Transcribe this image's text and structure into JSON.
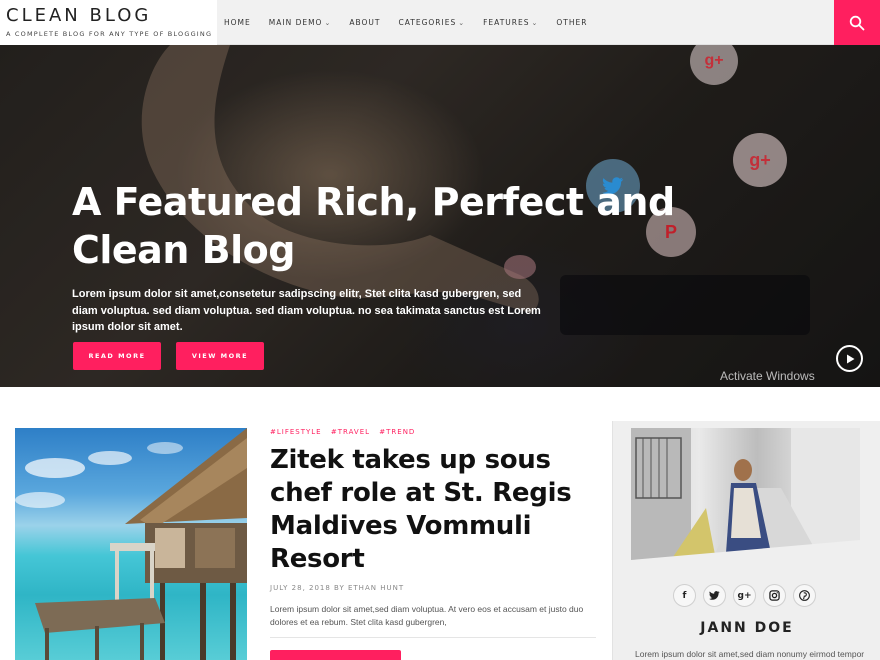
{
  "brand": {
    "title": "CLEAN BLOG",
    "tagline": "A COMPLETE BLOG FOR ANY TYPE OF BLOGGING"
  },
  "nav": {
    "items": [
      {
        "label": "HOME",
        "has_dropdown": false
      },
      {
        "label": "MAIN DEMO",
        "has_dropdown": true
      },
      {
        "label": "ABOUT",
        "has_dropdown": false
      },
      {
        "label": "CATEGORIES",
        "has_dropdown": true
      },
      {
        "label": "FEATURES",
        "has_dropdown": true
      },
      {
        "label": "OTHER",
        "has_dropdown": false
      }
    ],
    "chevron_glyph": "⌄",
    "search_icon": "search-icon"
  },
  "hero": {
    "title": "A Featured Rich, Perfect and Clean Blog",
    "description": "Lorem ipsum dolor sit amet,consetetur sadipscing elitr, Stet clita kasd gubergren, sed diam voluptua. sed diam voluptua. sed diam voluptua. no sea takimata sanctus est Lorem ipsum dolor sit amet.",
    "read_more_label": "READ MORE",
    "view_more_label": "VIEW MORE",
    "watermark": "Activate Windows"
  },
  "post": {
    "tags": [
      "#LIFESTYLE",
      "#TRAVEL",
      "#TREND"
    ],
    "title": "Zitek takes up sous chef role at St. Regis Maldives Vommuli Resort",
    "meta": "JULY 28, 2018   BY ETHAN HUNT",
    "excerpt": "Lorem ipsum dolor sit amet,sed diam voluptua. At vero eos et accusam et justo duo dolores et ea rebum. Stet clita kasd gubergren,"
  },
  "author": {
    "name": "JANN DOE",
    "bio": "Lorem ipsum dolor sit amet,sed diam nonumy eirmod tempor",
    "socials": [
      {
        "icon": "facebook-icon",
        "glyph": "f"
      },
      {
        "icon": "twitter-icon",
        "glyph": ""
      },
      {
        "icon": "google-plus-icon",
        "glyph": "g+"
      },
      {
        "icon": "instagram-icon",
        "glyph": ""
      },
      {
        "icon": "pinterest-icon",
        "glyph": "P"
      }
    ]
  },
  "colors": {
    "accent": "#ff1f5f",
    "header_bg": "#f1f1f1",
    "text_dark": "#111111"
  }
}
